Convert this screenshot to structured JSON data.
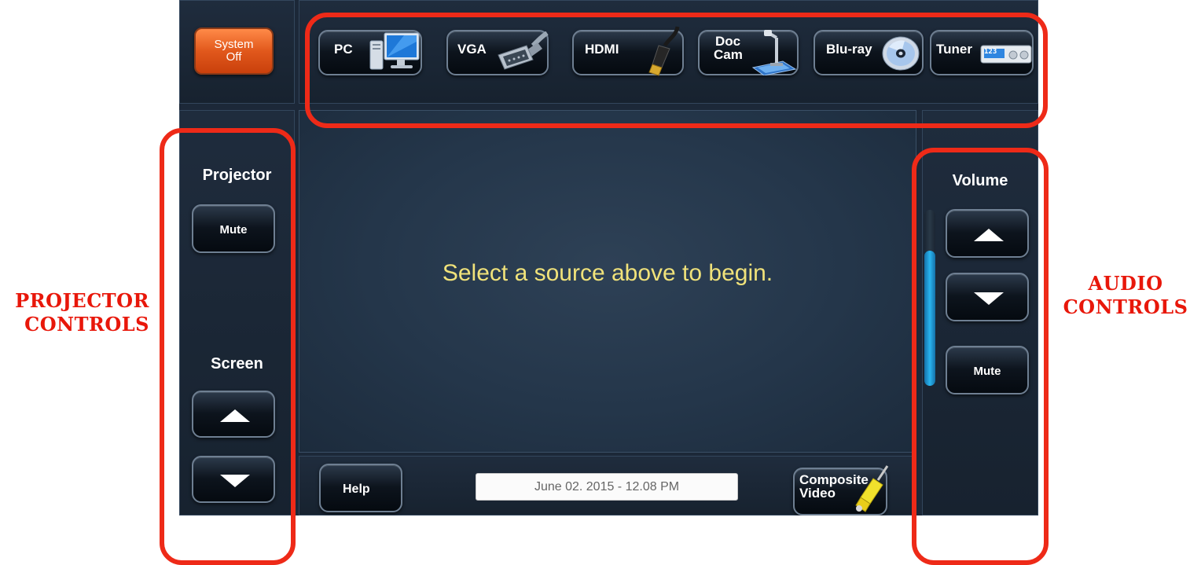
{
  "system": {
    "label_line1": "System",
    "label_line2": "Off",
    "color": "#e1581c"
  },
  "sources": [
    {
      "label": "PC",
      "icon": "monitor-icon"
    },
    {
      "label": "VGA",
      "icon": "vga-cable-icon"
    },
    {
      "label": "HDMI",
      "icon": "hdmi-cable-icon"
    },
    {
      "label_line1": "Doc",
      "label_line2": "Cam",
      "icon": "document-camera-icon"
    },
    {
      "label": "Blu-ray",
      "icon": "disc-icon"
    },
    {
      "label": "Tuner",
      "icon": "tuner-box-icon",
      "display": "123"
    }
  ],
  "projector": {
    "title": "Projector",
    "mute_label": "Mute"
  },
  "screen": {
    "title": "Screen"
  },
  "main": {
    "prompt": "Select a source above to begin."
  },
  "footer": {
    "help_label": "Help",
    "datetime": "June 02. 2015  -  12.08 PM",
    "composite_line1": "Composite",
    "composite_line2": "Video"
  },
  "volume": {
    "title": "Volume",
    "mute_label": "Mute",
    "level_percent": 77,
    "fill_color": "#29b5ef"
  },
  "annotations": {
    "projector_line1": "PROJECTOR",
    "projector_line2": "CONTROLS",
    "audio_line1": "AUDIO",
    "audio_line2": "CONTROLS",
    "callout_color": "#ee2a18"
  }
}
